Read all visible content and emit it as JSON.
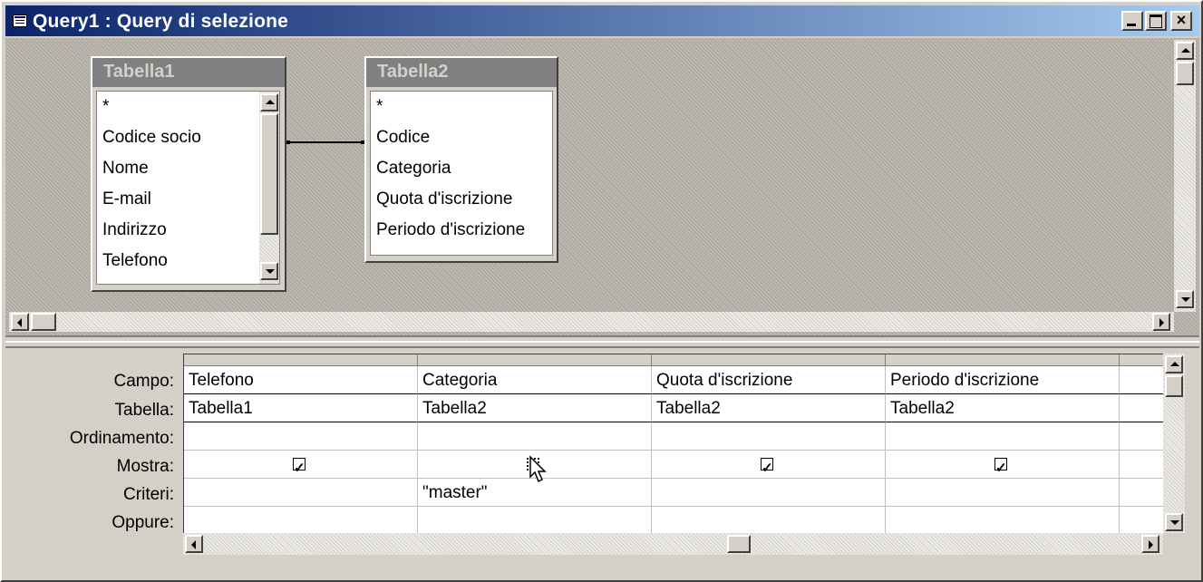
{
  "window": {
    "title": "Query1 : Query di selezione",
    "close_glyph": "×"
  },
  "tables": [
    {
      "title": "Tabella1",
      "fields": [
        "*",
        "Codice socio",
        "Nome",
        "E-mail",
        "Indirizzo",
        "Telefono"
      ]
    },
    {
      "title": "Tabella2",
      "fields": [
        "*",
        "Codice",
        "Categoria",
        "Quota d'iscrizione",
        "Periodo d'iscrizione"
      ]
    }
  ],
  "grid": {
    "row_labels": [
      "Campo:",
      "Tabella:",
      "Ordinamento:",
      "Mostra:",
      "Criteri:",
      "Oppure:"
    ],
    "columns": [
      {
        "campo": "Telefono",
        "tabella": "Tabella1",
        "ordinamento": "",
        "mostra": true,
        "criteri": "",
        "oppure": ""
      },
      {
        "campo": "Categoria",
        "tabella": "Tabella2",
        "ordinamento": "",
        "mostra": false,
        "criteri": "\"master\"",
        "oppure": ""
      },
      {
        "campo": "Quota d'iscrizione",
        "tabella": "Tabella2",
        "ordinamento": "",
        "mostra": true,
        "criteri": "",
        "oppure": ""
      },
      {
        "campo": "Periodo d'iscrizione",
        "tabella": "Tabella2",
        "ordinamento": "",
        "mostra": true,
        "criteri": "",
        "oppure": ""
      },
      {
        "campo": "",
        "tabella": "",
        "ordinamento": "",
        "mostra": null,
        "criteri": "",
        "oppure": ""
      }
    ]
  },
  "colors": {
    "title_gradient_start": "#0a246a",
    "title_gradient_end": "#a6caf0",
    "face": "#d4d0c8",
    "inactive_table_title": "#808080"
  }
}
